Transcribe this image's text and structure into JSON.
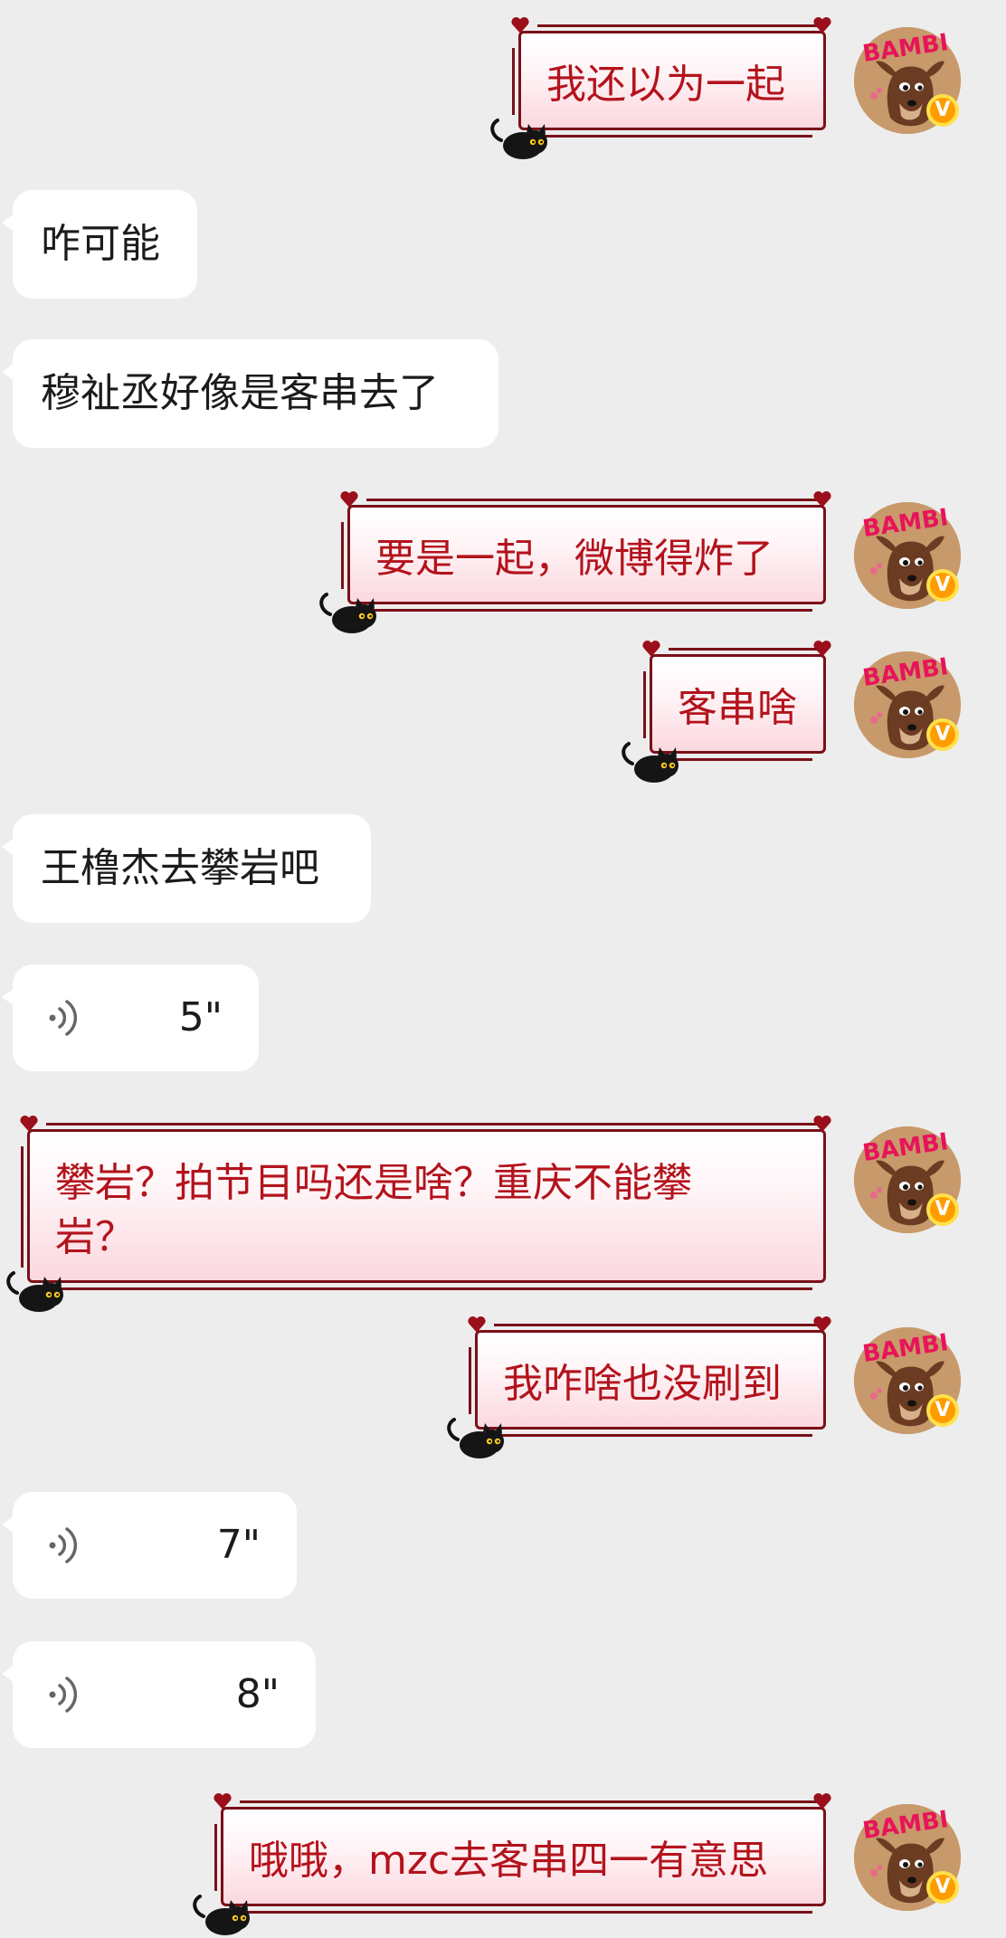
{
  "chat": {
    "messages": [
      {
        "side": "out",
        "text": "我还以为一起"
      },
      {
        "side": "in",
        "text": "咋可能"
      },
      {
        "side": "in",
        "text": "穆祉丞好像是客串去了"
      },
      {
        "side": "out",
        "text": "要是一起，微博得炸了"
      },
      {
        "side": "out",
        "text": "客串啥"
      },
      {
        "side": "in",
        "text": "王橹杰去攀岩吧"
      },
      {
        "side": "in",
        "type": "voice",
        "duration": "5\""
      },
      {
        "side": "out",
        "text": "攀岩？拍节目吗还是啥？重庆不能攀岩？"
      },
      {
        "side": "out",
        "text": "我咋啥也没刷到"
      },
      {
        "side": "in",
        "type": "voice",
        "duration": "7\""
      },
      {
        "side": "in",
        "type": "voice",
        "duration": "8\""
      },
      {
        "side": "out",
        "text": "哦哦，mzc去客串四一有意思"
      }
    ]
  },
  "avatar": {
    "logo_text": "BAMBI",
    "badge": "V",
    "icon": "bambi-avatar"
  },
  "colors": {
    "background": "#ededed",
    "incoming_bubble": "#ffffff",
    "outgoing_text": "#b3131c",
    "outgoing_border": "#7a1018",
    "badge": "#ff9d00"
  }
}
